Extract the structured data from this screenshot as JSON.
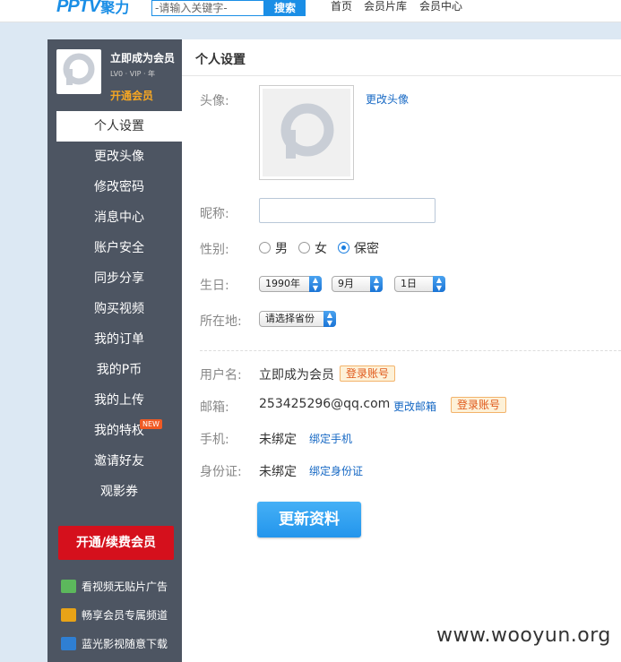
{
  "topbar": {
    "logo_pp": "PPTV",
    "logo_jl": "聚力",
    "search_placeholder": "-请输入关键字-",
    "search_btn": "搜索",
    "nav": [
      "首页",
      "会员片库",
      "会员中心"
    ]
  },
  "sidebar": {
    "profile_name": "立即成为会员",
    "vip_line": "LV0 · VIP · 年",
    "open_vip": "开通会员",
    "items": [
      {
        "label": "个人设置",
        "active": true
      },
      {
        "label": "更改头像"
      },
      {
        "label": "修改密码"
      },
      {
        "label": "消息中心"
      },
      {
        "label": "账户安全"
      },
      {
        "label": "同步分享"
      },
      {
        "label": "购买视频"
      },
      {
        "label": "我的订单"
      },
      {
        "label": "我的P币"
      },
      {
        "label": "我的上传"
      },
      {
        "label": "我的特权",
        "badge": "NEW"
      },
      {
        "label": "邀请好友"
      },
      {
        "label": "观影券"
      }
    ],
    "vip_button": "开通/续费会员",
    "perks": [
      "看视频无贴片广告",
      "畅享会员专属频道",
      "蓝光影视随意下载"
    ],
    "perk_colors": [
      "#5cb85c",
      "#e8a317",
      "#2f7fd3"
    ]
  },
  "main": {
    "title": "个人设置",
    "avatar_label": "头像:",
    "change_avatar": "更改头像",
    "nick_label": "昵称:",
    "gender_label": "性别:",
    "gender_options": [
      "男",
      "女",
      "保密"
    ],
    "gender_selected": "保密",
    "birthday_label": "生日:",
    "year": "1990年",
    "month": "9月",
    "day": "1日",
    "location_label": "所在地:",
    "location_value": "请选择省份",
    "username_label": "用户名:",
    "username_value": "立即成为会员",
    "login_badge": "登录账号",
    "email_label": "邮箱:",
    "email_value": "253425296@qq.com",
    "change_email": "更改邮箱",
    "phone_label": "手机:",
    "phone_value": "未绑定",
    "bind_phone": "绑定手机",
    "id_label": "身份证:",
    "id_value": "未绑定",
    "bind_id": "绑定身份证",
    "update_button": "更新资料"
  },
  "watermark": "www.wooyun.org",
  "colors": {
    "accent": "#1a8ee6",
    "sidebar": "#4d5562",
    "vip_red": "#d5101c"
  }
}
